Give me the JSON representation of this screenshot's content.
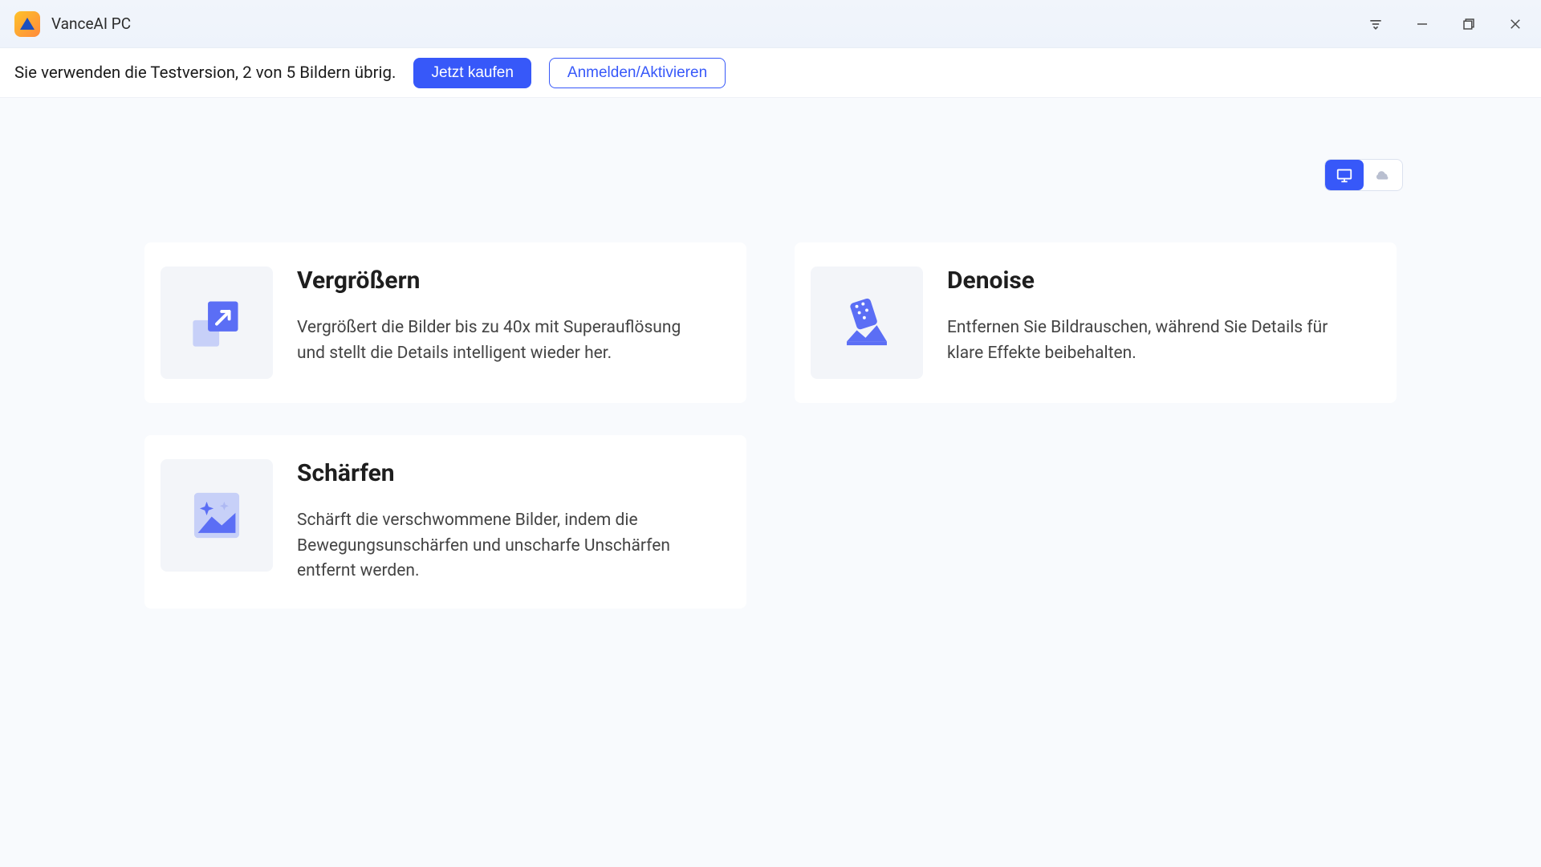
{
  "titlebar": {
    "app_title": "VanceAI PC"
  },
  "toolbar": {
    "trial_text": "Sie verwenden die Testversion, 2 von 5 Bildern übrig.",
    "buy_label": "Jetzt kaufen",
    "signin_label": "Anmelden/Aktivieren"
  },
  "cards": {
    "enlarge": {
      "title": "Vergrößern",
      "desc": "Vergrößert die Bilder bis zu 40x mit Superauflösung und stellt die Details intelligent wieder her."
    },
    "denoise": {
      "title": "Denoise",
      "desc": "Entfernen Sie Bildrauschen, während Sie Details für klare Effekte beibehalten."
    },
    "sharpen": {
      "title": "Schärfen",
      "desc": "Schärft die verschwommene Bilder, indem die Bewegungsunschärfen und unscharfe Unschärfen entfernt werden."
    }
  }
}
